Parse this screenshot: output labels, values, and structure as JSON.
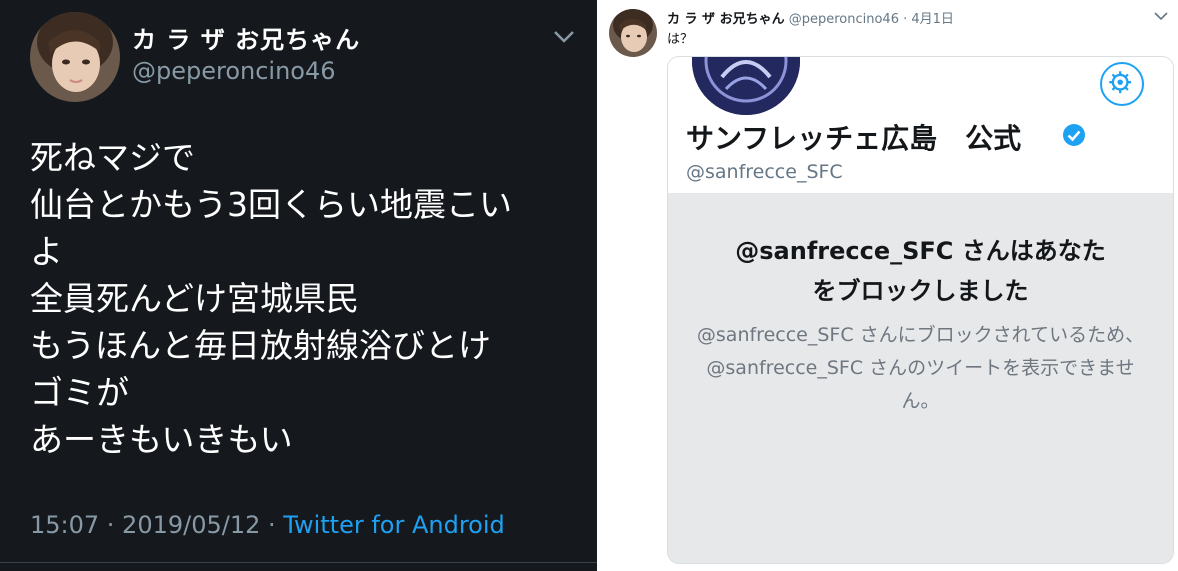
{
  "left_tweet": {
    "display_name": "カ ラ ザ お兄ちゃん",
    "handle": "@peperoncino46",
    "body_lines": [
      "死ねマジで",
      "仙台とかもう3回くらい地震こい",
      "よ",
      "全員死んどけ宮城県民",
      "もうほんと毎日放射線浴びとけ",
      "ゴミが",
      "あーきもいきもい"
    ],
    "timestamp": "15:07 · 2019/05/12 · ",
    "source": "Twitter for Android"
  },
  "right_tweet": {
    "display_name": "カ ラ ザ お兄ちゃん",
    "handle": "@peperoncino46",
    "separator": "·",
    "date": "4月1日",
    "text": "は？",
    "card": {
      "profile_name": "サンフレッチェ広島　公式",
      "profile_handle": "@sanfrecce_SFC",
      "blocked_title_lines": [
        "@sanfrecce_SFC さんはあなた",
        "をブロックしました"
      ],
      "blocked_desc_lines": [
        "@sanfrecce_SFC さんにブロックされているため、",
        "@sanfrecce_SFC さんのツイートを表示できませ",
        "ん。"
      ]
    }
  },
  "icons": {
    "chevron": "chevron-down-icon",
    "gear": "gear-icon",
    "verified": "verified-badge-icon",
    "avatar": "avatar"
  },
  "colors": {
    "dark_bg": "#15181c",
    "accent_blue": "#1da1f2",
    "muted_gray": "#8899a6",
    "card_gray": "#e7e8ea"
  }
}
